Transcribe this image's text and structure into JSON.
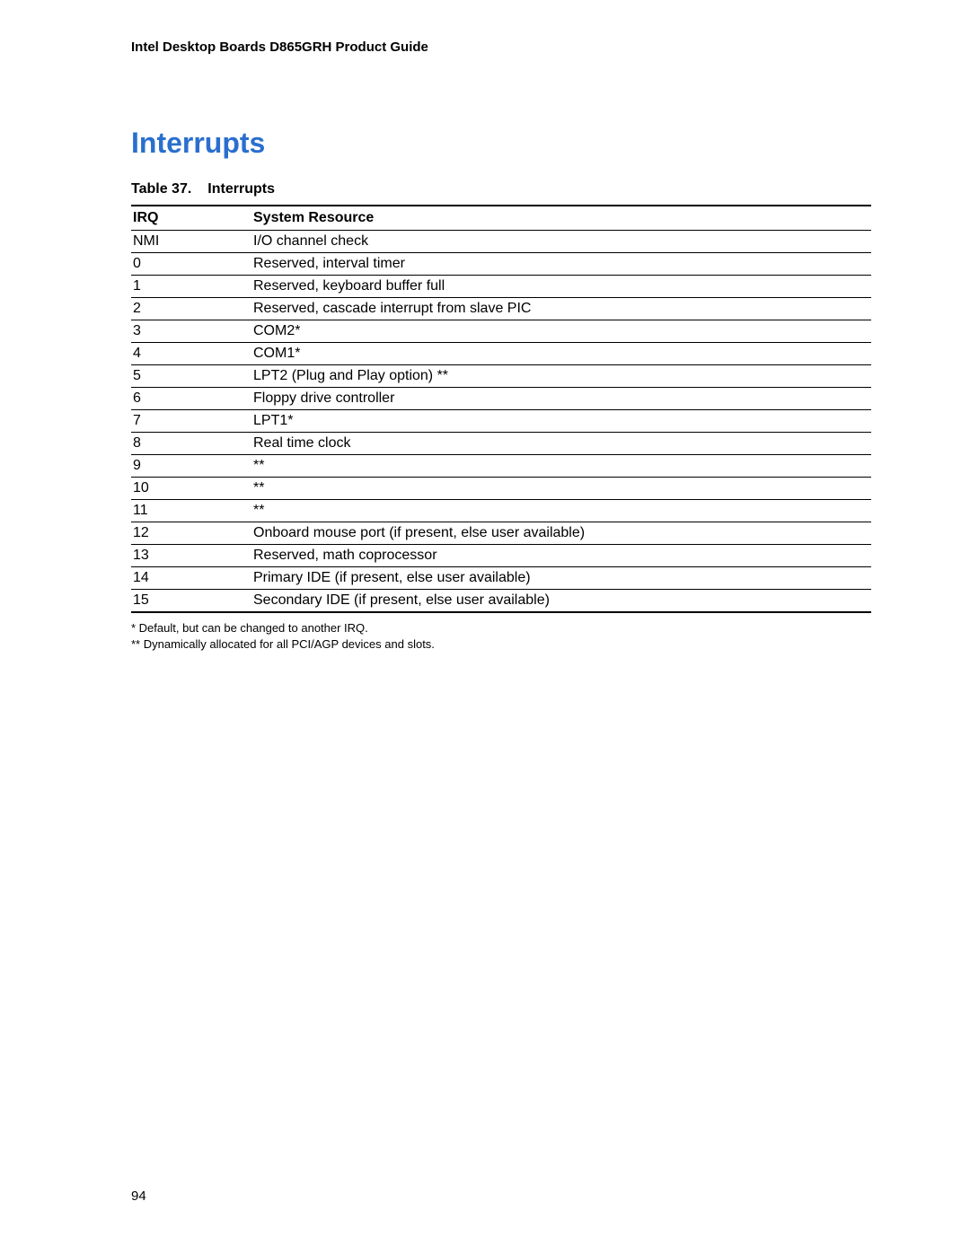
{
  "header": {
    "title": "Intel Desktop Boards D865GRH Product Guide"
  },
  "section": {
    "heading": "Interrupts"
  },
  "table": {
    "caption_prefix": "Table 37.",
    "caption_title": "Interrupts",
    "columns": {
      "irq": "IRQ",
      "resource": "System Resource"
    },
    "rows": [
      {
        "irq": "NMI",
        "resource": "I/O channel check"
      },
      {
        "irq": "0",
        "resource": "Reserved, interval timer"
      },
      {
        "irq": "1",
        "resource": "Reserved, keyboard buffer full"
      },
      {
        "irq": "2",
        "resource": "Reserved, cascade interrupt from slave PIC"
      },
      {
        "irq": "3",
        "resource": "COM2*"
      },
      {
        "irq": "4",
        "resource": "COM1*"
      },
      {
        "irq": "5",
        "resource": "LPT2 (Plug and Play option) **"
      },
      {
        "irq": "6",
        "resource": "Floppy drive controller"
      },
      {
        "irq": "7",
        "resource": "LPT1*"
      },
      {
        "irq": "8",
        "resource": "Real time clock"
      },
      {
        "irq": "9",
        "resource": "**"
      },
      {
        "irq": "10",
        "resource": "**"
      },
      {
        "irq": "11",
        "resource": "**"
      },
      {
        "irq": "12",
        "resource": "Onboard mouse port (if present, else user available)"
      },
      {
        "irq": "13",
        "resource": "Reserved, math coprocessor"
      },
      {
        "irq": "14",
        "resource": "Primary IDE (if present, else user available)"
      },
      {
        "irq": "15",
        "resource": "Secondary IDE (if present, else user available)"
      }
    ]
  },
  "footnotes": [
    "*   Default, but can be changed to another IRQ.",
    "** Dynamically allocated for all PCI/AGP devices and slots."
  ],
  "page_number": "94"
}
